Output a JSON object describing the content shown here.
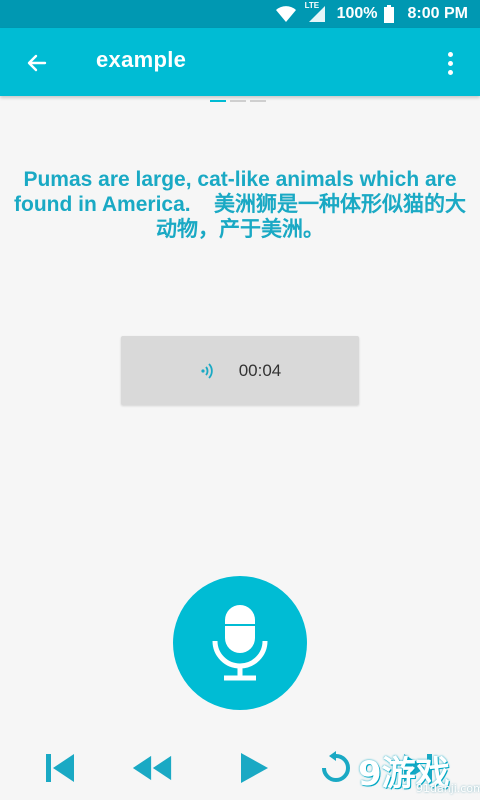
{
  "status": {
    "signal_label": "LTE",
    "battery": "100%",
    "time": "8:00 PM"
  },
  "appbar": {
    "title": "example"
  },
  "sentence": {
    "en": "Pumas are large, cat-like animals which are found in America.",
    "zh": "美洲狮是一种体形似猫的大动物，产于美洲。"
  },
  "player": {
    "duration": "00:04"
  },
  "watermark": {
    "main": "9游戏",
    "sub": "91danji.com"
  },
  "colors": {
    "accent": "#00bcd4",
    "status_bar": "#0098b2",
    "text_accent": "#1aa9c4"
  }
}
